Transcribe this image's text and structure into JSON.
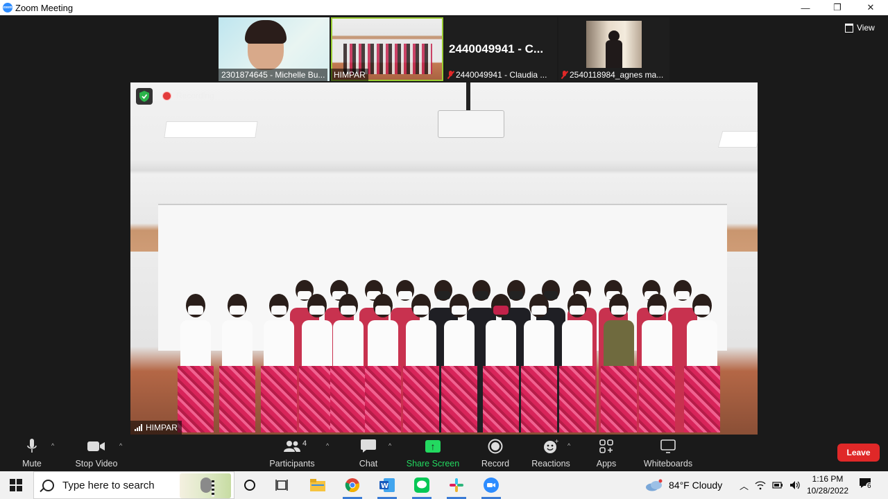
{
  "window": {
    "title": "Zoom Meeting",
    "minimize": "—",
    "restore": "❐",
    "close": "✕"
  },
  "thumbnails": [
    {
      "label": "2301874645 - Michelle Bu...",
      "muted": false
    },
    {
      "label": "HIMPAR",
      "muted": false,
      "active": true
    },
    {
      "label": "2440049941 - Claudia ...",
      "big_name": "2440049941  - C...",
      "muted": true
    },
    {
      "label": "2540118984_agnes ma...",
      "muted": true
    }
  ],
  "view": {
    "label": "View"
  },
  "main_video": {
    "recording_label": "Recording",
    "speaker_label": "HIMPAR"
  },
  "toolbar": {
    "mute": "Mute",
    "stop_video": "Stop Video",
    "participants": "Participants",
    "participants_count": "4",
    "chat": "Chat",
    "share_screen": "Share Screen",
    "record": "Record",
    "reactions": "Reactions",
    "apps": "Apps",
    "whiteboards": "Whiteboards",
    "leave": "Leave"
  },
  "taskbar": {
    "search_placeholder": "Type here to search",
    "weather": "84°F  Cloudy",
    "time": "1:16 PM",
    "date": "10/28/2022",
    "notifications_count": "6"
  },
  "colors": {
    "leave": "#e02828",
    "share": "#23d960",
    "active_thumb": "#9acd32",
    "recording": "#e23b3b"
  }
}
